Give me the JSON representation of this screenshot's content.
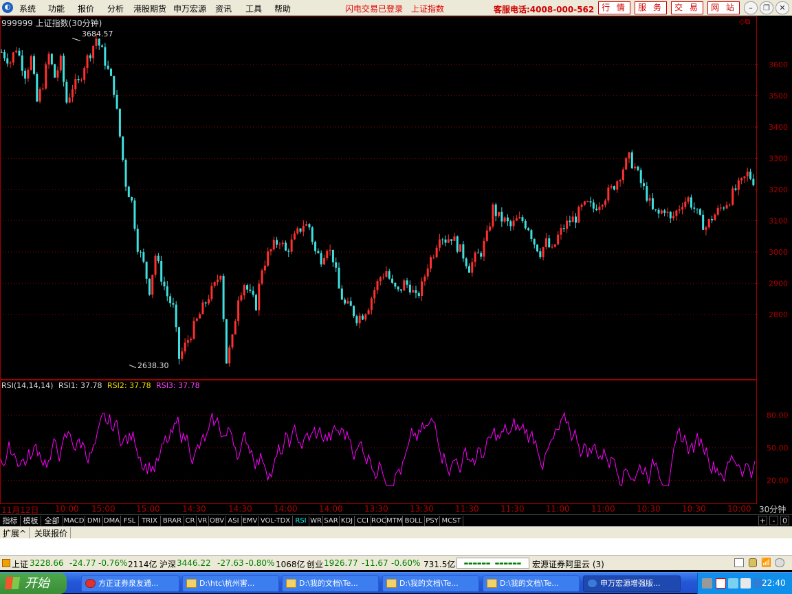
{
  "menubar": {
    "items": [
      "系统",
      "功能",
      "报价",
      "分析",
      "港股期货",
      "申万宏源",
      "资讯",
      "工具",
      "帮助"
    ],
    "status_login": "闪电交易已登录",
    "status_index": "上证指数",
    "hotline": "客服电话:4008-000-562",
    "buttons": [
      "行 情",
      "服 务",
      "交 易",
      "网 站"
    ]
  },
  "chart": {
    "title": "999999 上证指数(30分钟)",
    "high_label": "3684.57",
    "low_label": "2638.30",
    "rsi_title": "RSI(14,14,14)",
    "rsi1": "RSI1: 37.78",
    "rsi2": "RSI2: 37.78",
    "rsi3": "RSI3: 37.78",
    "timeframe": "30分钟",
    "time_labels": [
      "11月12日",
      "10:00",
      "15:00",
      "15:00",
      "14:30",
      "14:30",
      "14:00",
      "14:00",
      "13:30",
      "13:30",
      "11:30",
      "11:30",
      "11:00",
      "11:00",
      "10:30",
      "10:30",
      "10:00"
    ]
  },
  "chart_data": {
    "type": "candlestick",
    "title": "999999 上证指数(30分钟)",
    "y_ticks": [
      2800,
      2900,
      3000,
      3100,
      3200,
      3300,
      3400,
      3500,
      3600
    ],
    "ylim": [
      2635,
      3690
    ],
    "high": 3684.57,
    "low": 2638.3,
    "price_anchors": [
      [
        0,
        3640
      ],
      [
        3,
        3610
      ],
      [
        5,
        3655
      ],
      [
        8,
        3570
      ],
      [
        10,
        3620
      ],
      [
        12,
        3480
      ],
      [
        14,
        3540
      ],
      [
        16,
        3630
      ],
      [
        18,
        3560
      ],
      [
        20,
        3610
      ],
      [
        22,
        3480
      ],
      [
        24,
        3530
      ],
      [
        26,
        3540
      ],
      [
        28,
        3600
      ],
      [
        30,
        3640
      ],
      [
        32,
        3684
      ],
      [
        34,
        3640
      ],
      [
        36,
        3580
      ],
      [
        38,
        3520
      ],
      [
        40,
        3370
      ],
      [
        42,
        3220
      ],
      [
        44,
        3160
      ],
      [
        46,
        3020
      ],
      [
        48,
        2960
      ],
      [
        50,
        2880
      ],
      [
        52,
        2990
      ],
      [
        54,
        2920
      ],
      [
        56,
        2860
      ],
      [
        58,
        2820
      ],
      [
        60,
        2660
      ],
      [
        62,
        2700
      ],
      [
        64,
        2740
      ],
      [
        66,
        2780
      ],
      [
        68,
        2820
      ],
      [
        70,
        2860
      ],
      [
        72,
        2890
      ],
      [
        74,
        2940
      ],
      [
        76,
        2650
      ],
      [
        78,
        2720
      ],
      [
        80,
        2860
      ],
      [
        82,
        2900
      ],
      [
        84,
        2860
      ],
      [
        86,
        2830
      ],
      [
        88,
        2950
      ],
      [
        90,
        2990
      ],
      [
        92,
        3020
      ],
      [
        94,
        3040
      ],
      [
        96,
        3000
      ],
      [
        98,
        3030
      ],
      [
        100,
        3060
      ],
      [
        102,
        3090
      ],
      [
        104,
        3080
      ],
      [
        106,
        3000
      ],
      [
        108,
        2980
      ],
      [
        110,
        3020
      ],
      [
        112,
        2980
      ],
      [
        114,
        2880
      ],
      [
        116,
        2830
      ],
      [
        118,
        2820
      ],
      [
        120,
        2790
      ],
      [
        122,
        2800
      ],
      [
        124,
        2830
      ],
      [
        126,
        2880
      ],
      [
        128,
        2920
      ],
      [
        130,
        2940
      ],
      [
        132,
        2890
      ],
      [
        134,
        2870
      ],
      [
        136,
        2900
      ],
      [
        138,
        2890
      ],
      [
        140,
        2850
      ],
      [
        142,
        2890
      ],
      [
        144,
        2960
      ],
      [
        146,
        3000
      ],
      [
        148,
        3060
      ],
      [
        150,
        3040
      ],
      [
        152,
        3050
      ],
      [
        154,
        3020
      ],
      [
        156,
        2990
      ],
      [
        158,
        2950
      ],
      [
        160,
        2980
      ],
      [
        162,
        3000
      ],
      [
        164,
        3050
      ],
      [
        166,
        3140
      ],
      [
        168,
        3110
      ],
      [
        170,
        3100
      ],
      [
        172,
        3080
      ],
      [
        174,
        3100
      ],
      [
        176,
        3100
      ],
      [
        178,
        3080
      ],
      [
        180,
        3030
      ],
      [
        182,
        3000
      ],
      [
        184,
        3030
      ],
      [
        186,
        3000
      ],
      [
        188,
        3050
      ],
      [
        190,
        3080
      ],
      [
        192,
        3100
      ],
      [
        194,
        3110
      ],
      [
        196,
        3140
      ],
      [
        198,
        3150
      ],
      [
        200,
        3140
      ],
      [
        202,
        3160
      ],
      [
        204,
        3180
      ],
      [
        206,
        3200
      ],
      [
        208,
        3230
      ],
      [
        210,
        3270
      ],
      [
        212,
        3300
      ],
      [
        214,
        3270
      ],
      [
        216,
        3220
      ],
      [
        218,
        3180
      ],
      [
        220,
        3130
      ],
      [
        222,
        3120
      ],
      [
        224,
        3140
      ],
      [
        226,
        3100
      ],
      [
        228,
        3130
      ],
      [
        230,
        3160
      ],
      [
        232,
        3170
      ],
      [
        234,
        3140
      ],
      [
        236,
        3100
      ],
      [
        238,
        3080
      ],
      [
        240,
        3110
      ],
      [
        242,
        3130
      ],
      [
        244,
        3150
      ],
      [
        246,
        3170
      ],
      [
        248,
        3200
      ],
      [
        250,
        3220
      ],
      [
        252,
        3250
      ],
      [
        254,
        3230
      ]
    ],
    "candle_count": 255,
    "rsi": {
      "name": "RSI1",
      "last": 37.78,
      "ylim": [
        0,
        100
      ],
      "ticks": [
        20,
        50,
        80
      ]
    },
    "timeframe": "30分钟"
  },
  "tabs": [
    "指标",
    "模板",
    "全部",
    "MACD",
    "DMI",
    "DMA",
    "FSL",
    "TRIX",
    "BRAR",
    "CR",
    "VR",
    "OBV",
    "ASI",
    "EMV",
    "VOL-TDX",
    "RSI",
    "WR",
    "SAR",
    "KDJ",
    "CCI",
    "ROC",
    "MTM",
    "BOLL",
    "PSY",
    "MCST"
  ],
  "active_tab": "RSI",
  "tab_controls": [
    "+",
    "-",
    "0"
  ],
  "extbar": [
    "扩展^",
    "关联报价"
  ],
  "statusbar": {
    "sh_label": "上证",
    "sh_value": "3228.66",
    "sh_change": "-24.77",
    "sh_pct": "-0.76%",
    "sh_amount": "2114亿",
    "hs_label": "沪深",
    "hs_value": "3446.22",
    "hs_change": "-27.63",
    "hs_pct": "-0.80%",
    "hs_amount": "1068亿",
    "cy_label": "创业",
    "cy_value": "1926.77",
    "cy_change": "-11.67",
    "cy_pct": "-0.60%",
    "cy_amount": "731.5亿",
    "broker": "宏源证券阿里云 (3)"
  },
  "taskbar": {
    "start": "开始",
    "tasks": [
      "方正证券泉友通...",
      "D:\\htc\\杭州害...",
      "D:\\我的文档\\Te...",
      "D:\\我的文档\\Te...",
      "D:\\我的文档\\Te...",
      "申万宏源增强版..."
    ],
    "clock": "22:40"
  },
  "colors": {
    "up": "#ff3030",
    "down": "#40e0e0",
    "rsi": "#ff00ff",
    "grid": "#a00000",
    "axis": "#b00000"
  }
}
